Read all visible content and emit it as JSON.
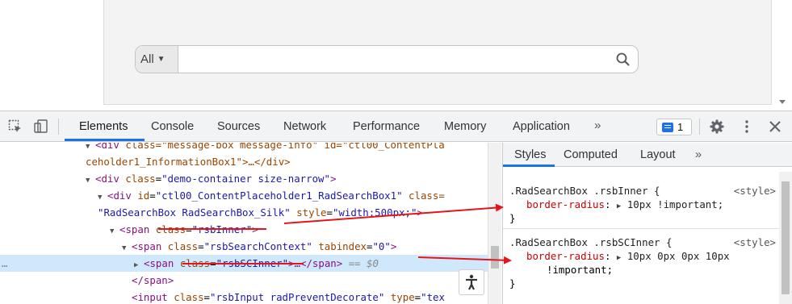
{
  "search": {
    "context_label": "All",
    "input_value": "",
    "input_placeholder": ""
  },
  "devtools": {
    "tabs": [
      "Elements",
      "Console",
      "Sources",
      "Network",
      "Performance",
      "Memory",
      "Application"
    ],
    "more_tabs": "»",
    "issues_count": "1",
    "elements": {
      "line0": {
        "pre": "<",
        "tag": "div",
        "mid": " class=\"message-box message-info\" id=\"ctl00_ContentPla"
      },
      "line1": {
        "text": "ceholder1_InformationBox1\">…</div>"
      },
      "line2": {
        "tag_open": "<div",
        "attr": "class",
        "val": "\"demo-container size-narrow\"",
        "close": ">"
      },
      "line3": {
        "tag_open": "<div",
        "attr1": "id",
        "val1": "\"ctl00_ContentPlaceholder1_RadSearchBox1\"",
        "attr2": "class="
      },
      "line4": {
        "val2": "\"RadSearchBox RadSearchBox_Silk\"",
        "attr3": "style",
        "val3": "\"width:500px;\"",
        "close": ">"
      },
      "line5": {
        "tag_open": "<span",
        "attr": "class",
        "val": "\"rsbInner\"",
        "close": ">"
      },
      "line6": {
        "tag_open": "<span",
        "attr1": "class",
        "val1": "\"rsbSearchContext\"",
        "attr2": "tabindex",
        "val2": "\"0\"",
        "close": ">"
      },
      "line7": {
        "tag_open": "<span",
        "attr": "class",
        "val": "\"rsbSCInner\"",
        "ellipsis": ">…</span>",
        "eq": " == $0"
      },
      "line8": {
        "text": "</span>"
      },
      "line9": {
        "tag_open": "<input",
        "attr1": "class",
        "val1": "\"rsbInput radPreventDecorate\"",
        "attr2": "type",
        "val2": "\"tex"
      },
      "dots": "…"
    },
    "styles": {
      "tabs": [
        "Styles",
        "Computed",
        "Layout"
      ],
      "more_tabs": "»",
      "rules": [
        {
          "selector": ".RadSearchBox .rsbInner {",
          "source": "<style>",
          "property": "border-radius",
          "colon": ":",
          "value": "10px !important;",
          "close": "}"
        },
        {
          "selector": ".RadSearchBox .rsbSCInner {",
          "source": "<style>",
          "property": "border-radius",
          "colon": ":",
          "value": "10px 0px 0px 10px",
          "value2": "!important;",
          "close": "}"
        }
      ]
    }
  },
  "colors": {
    "accent": "#1a73e8",
    "annotation_red": "#e3161b",
    "tag": "#881280",
    "attribute": "#994500",
    "attribute_value": "#1a1aa6"
  }
}
